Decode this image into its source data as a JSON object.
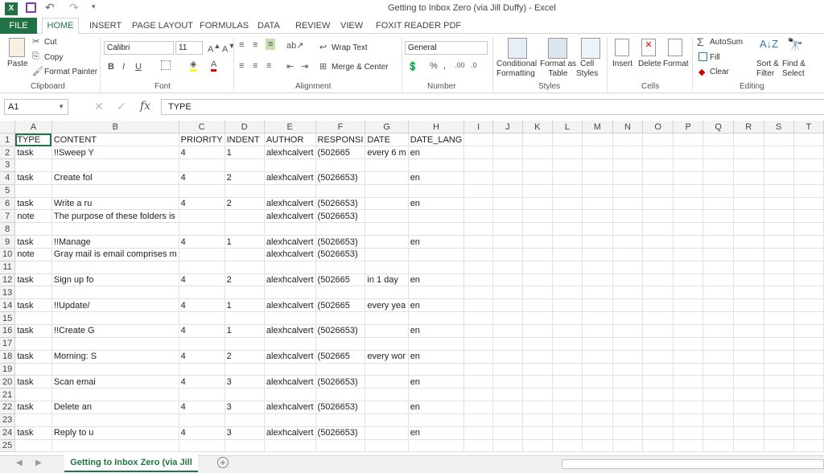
{
  "title": "Getting to Inbox Zero (via Jill Duffy) - Excel",
  "tabs": [
    "FILE",
    "HOME",
    "INSERT",
    "PAGE LAYOUT",
    "FORMULAS",
    "DATA",
    "REVIEW",
    "VIEW",
    "FOXIT READER PDF"
  ],
  "clipboard": {
    "paste": "Paste",
    "cut": "Cut",
    "copy": "Copy",
    "format_painter": "Format Painter",
    "label": "Clipboard"
  },
  "font": {
    "name": "Calibri",
    "size": "11",
    "label": "Font"
  },
  "alignment": {
    "wrap": "Wrap Text",
    "merge": "Merge & Center",
    "label": "Alignment"
  },
  "number": {
    "format": "General",
    "label": "Number"
  },
  "styles": {
    "cond1": "Conditional",
    "cond2": "Formatting",
    "fmt1": "Format as",
    "fmt2": "Table",
    "cell1": "Cell",
    "cell2": "Styles",
    "label": "Styles"
  },
  "cells": {
    "insert": "Insert",
    "delete": "Delete",
    "format": "Format",
    "label": "Cells"
  },
  "editing": {
    "autosum": "AutoSum",
    "fill": "Fill",
    "clear": "Clear",
    "sort1": "Sort &",
    "sort2": "Filter",
    "find1": "Find &",
    "find2": "Select",
    "label": "Editing"
  },
  "namebox": "A1",
  "formula": "TYPE",
  "fx": "fx",
  "columns": [
    "A",
    "B",
    "C",
    "D",
    "E",
    "F",
    "G",
    "H",
    "I",
    "J",
    "K",
    "L",
    "M",
    "N",
    "O",
    "P",
    "Q",
    "R",
    "S",
    "T"
  ],
  "rows": [
    [
      "TYPE",
      "CONTENT",
      "PRIORITY",
      "INDENT",
      "AUTHOR",
      "RESPONSI",
      "DATE",
      "DATE_LANG"
    ],
    [
      "task",
      "!!Sweep Y",
      "4",
      "1",
      "alexhcalvert",
      "(502665",
      "every 6 m",
      "en"
    ],
    [
      "",
      "",
      "",
      "",
      "",
      "",
      "",
      ""
    ],
    [
      "task",
      "Create fol",
      "4",
      "2",
      "alexhcalvert",
      "(5026653)",
      "",
      "en"
    ],
    [
      "",
      "",
      "",
      "",
      "",
      "",
      "",
      ""
    ],
    [
      "task",
      "Write a ru",
      "4",
      "2",
      "alexhcalvert",
      "(5026653)",
      "",
      "en"
    ],
    [
      "note",
      "The purpose of these folders is",
      "",
      "",
      "alexhcalvert",
      "(5026653)",
      "",
      ""
    ],
    [
      "",
      "",
      "",
      "",
      "",
      "",
      "",
      ""
    ],
    [
      "task",
      "!!Manage",
      "4",
      "1",
      "alexhcalvert",
      "(5026653)",
      "",
      "en"
    ],
    [
      "note",
      "Gray mail is email comprises m",
      "",
      "",
      "alexhcalvert",
      "(5026653)",
      "",
      ""
    ],
    [
      "",
      "",
      "",
      "",
      "",
      "",
      "",
      ""
    ],
    [
      "task",
      "Sign up fo",
      "4",
      "2",
      "alexhcalvert",
      "(502665",
      "in 1 day",
      "en"
    ],
    [
      "",
      "",
      "",
      "",
      "",
      "",
      "",
      ""
    ],
    [
      "task",
      "!!Update/",
      "4",
      "1",
      "alexhcalvert",
      "(502665",
      "every yea",
      "en"
    ],
    [
      "",
      "",
      "",
      "",
      "",
      "",
      "",
      ""
    ],
    [
      "task",
      "!!Create G",
      "4",
      "1",
      "alexhcalvert",
      "(5026653)",
      "",
      "en"
    ],
    [
      "",
      "",
      "",
      "",
      "",
      "",
      "",
      ""
    ],
    [
      "task",
      "Morning: S",
      "4",
      "2",
      "alexhcalvert",
      "(502665",
      "every wor",
      "en"
    ],
    [
      "",
      "",
      "",
      "",
      "",
      "",
      "",
      ""
    ],
    [
      "task",
      "Scan emai",
      "4",
      "3",
      "alexhcalvert",
      "(5026653)",
      "",
      "en"
    ],
    [
      "",
      "",
      "",
      "",
      "",
      "",
      "",
      ""
    ],
    [
      "task",
      "Delete an",
      "4",
      "3",
      "alexhcalvert",
      "(5026653)",
      "",
      "en"
    ],
    [
      "",
      "",
      "",
      "",
      "",
      "",
      "",
      ""
    ],
    [
      "task",
      "Reply to u",
      "4",
      "3",
      "alexhcalvert",
      "(5026653)",
      "",
      "en"
    ],
    [
      "",
      "",
      "",
      "",
      "",
      "",
      "",
      ""
    ]
  ],
  "sheet_tab": "Getting to Inbox Zero (via Jill",
  "colors": {
    "accent": "#217346"
  }
}
